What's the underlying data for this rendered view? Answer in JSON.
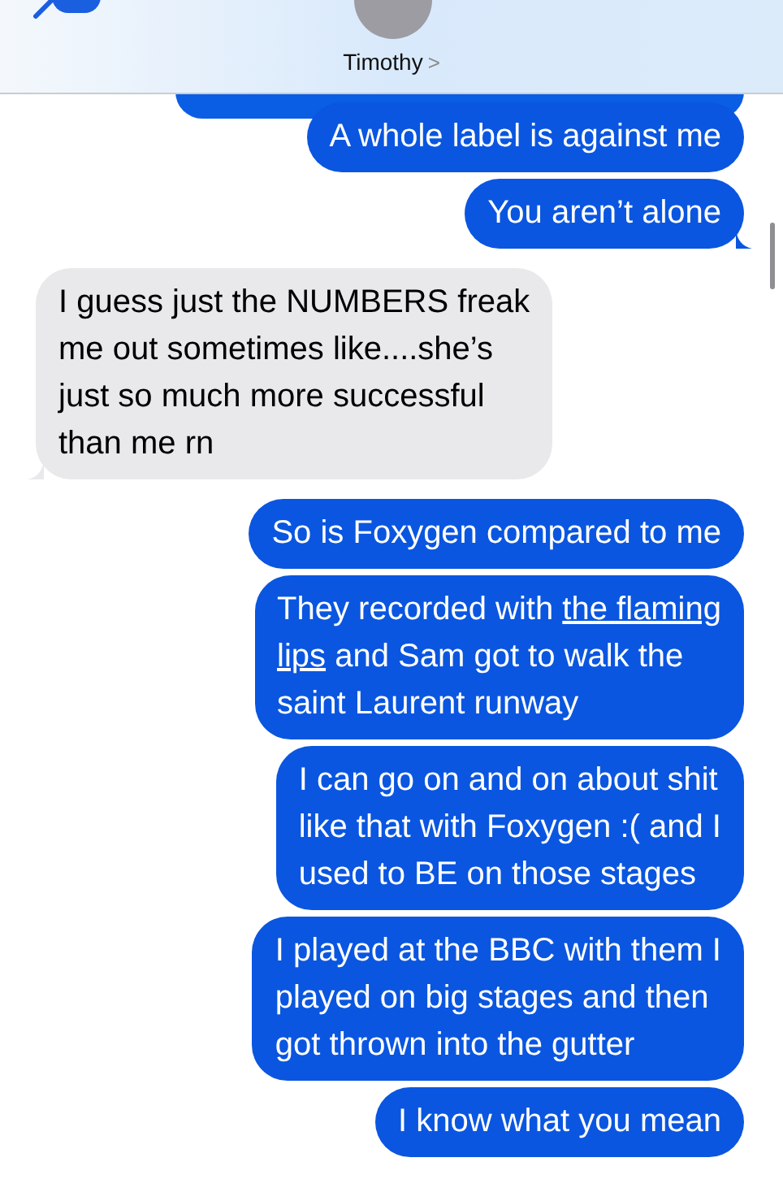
{
  "header": {
    "contact_name": "Timothy",
    "chevron": ">"
  },
  "messages": [
    {
      "kind": "sent",
      "tail": false,
      "lines": [
        [
          {
            "text": "A whole label is against me"
          }
        ]
      ]
    },
    {
      "kind": "sent",
      "tail": true,
      "lines": [
        [
          {
            "text": "You aren’t alone"
          }
        ]
      ]
    },
    {
      "kind": "received",
      "tail": true,
      "lines": [
        [
          {
            "text": "I guess just the NUMBERS freak"
          }
        ],
        [
          {
            "text": "me out sometimes like....she’s"
          }
        ],
        [
          {
            "text": "just so much more successful"
          }
        ],
        [
          {
            "text": "than me rn"
          }
        ]
      ]
    },
    {
      "kind": "sent",
      "tail": false,
      "lines": [
        [
          {
            "text": "So is Foxygen compared to me"
          }
        ]
      ]
    },
    {
      "kind": "sent",
      "tail": false,
      "lines": [
        [
          {
            "text": "They recorded with "
          },
          {
            "text": "the flaming",
            "link": true
          }
        ],
        [
          {
            "text": "lips",
            "link": true
          },
          {
            "text": " and Sam got to walk the"
          }
        ],
        [
          {
            "text": "saint Laurent runway"
          }
        ]
      ]
    },
    {
      "kind": "sent",
      "tail": false,
      "lines": [
        [
          {
            "text": "I can go on and on about shit"
          }
        ],
        [
          {
            "text": "like that with Foxygen :( and I"
          }
        ],
        [
          {
            "text": "used to BE on those stages"
          }
        ]
      ]
    },
    {
      "kind": "sent",
      "tail": false,
      "lines": [
        [
          {
            "text": "I played at the BBC with them I"
          }
        ],
        [
          {
            "text": "played on big stages and then"
          }
        ],
        [
          {
            "text": "got thrown into the gutter"
          }
        ]
      ]
    },
    {
      "kind": "sent",
      "tail": false,
      "lines": [
        [
          {
            "text": "I know what you mean"
          }
        ]
      ]
    }
  ]
}
